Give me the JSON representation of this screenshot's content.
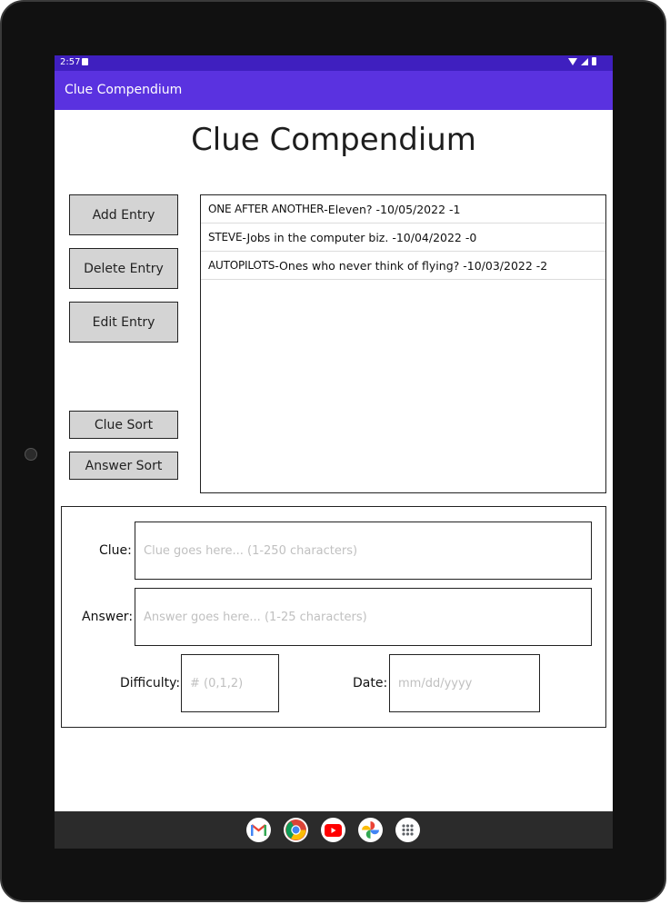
{
  "status": {
    "time": "2:57"
  },
  "appbar": {
    "title": "Clue Compendium"
  },
  "page": {
    "title": "Clue Compendium"
  },
  "buttons": {
    "add": "Add Entry",
    "delete": "Delete Entry",
    "edit": "Edit Entry",
    "clue_sort": "Clue Sort",
    "answer_sort": "Answer Sort"
  },
  "entries": [
    {
      "answer": "ONE AFTER ANOTHER",
      "rest": " -Eleven? -10/05/2022 -1"
    },
    {
      "answer": "STEVE",
      "rest": " -Jobs in the computer biz. -10/04/2022 -0"
    },
    {
      "answer": "AUTOPILOTS",
      "rest": " -Ones who never think of flying? -10/03/2022 -2"
    }
  ],
  "form": {
    "clue_label": "Clue:",
    "clue_placeholder": "Clue goes here... (1-250 characters)",
    "answer_label": "Answer:",
    "answer_placeholder": "Answer goes here... (1-25 characters)",
    "difficulty_label": "Difficulty:",
    "difficulty_placeholder": "# (0,1,2)",
    "date_label": "Date:",
    "date_placeholder": "mm/dd/yyyy"
  },
  "dock": {
    "apps": [
      "gmail-icon",
      "chrome-icon",
      "youtube-icon",
      "photos-icon",
      "app-drawer-icon"
    ]
  },
  "colors": {
    "statusbar": "#3f1fbf",
    "appbar": "#5a32e0",
    "button_bg": "#d4d4d4",
    "dock_bg": "#2b2b2b"
  }
}
